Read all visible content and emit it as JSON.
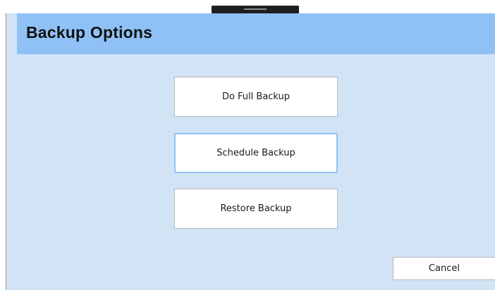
{
  "dialog": {
    "title": "Backup Options",
    "accent_color": "#8fc1f6",
    "background_color": "#d3e3f6"
  },
  "options": {
    "full_backup_label": "Do Full Backup",
    "schedule_backup_label": "Schedule Backup",
    "restore_backup_label": "Restore Backup",
    "focused_option": "Schedule Backup"
  },
  "footer": {
    "cancel_label": "Cancel"
  }
}
